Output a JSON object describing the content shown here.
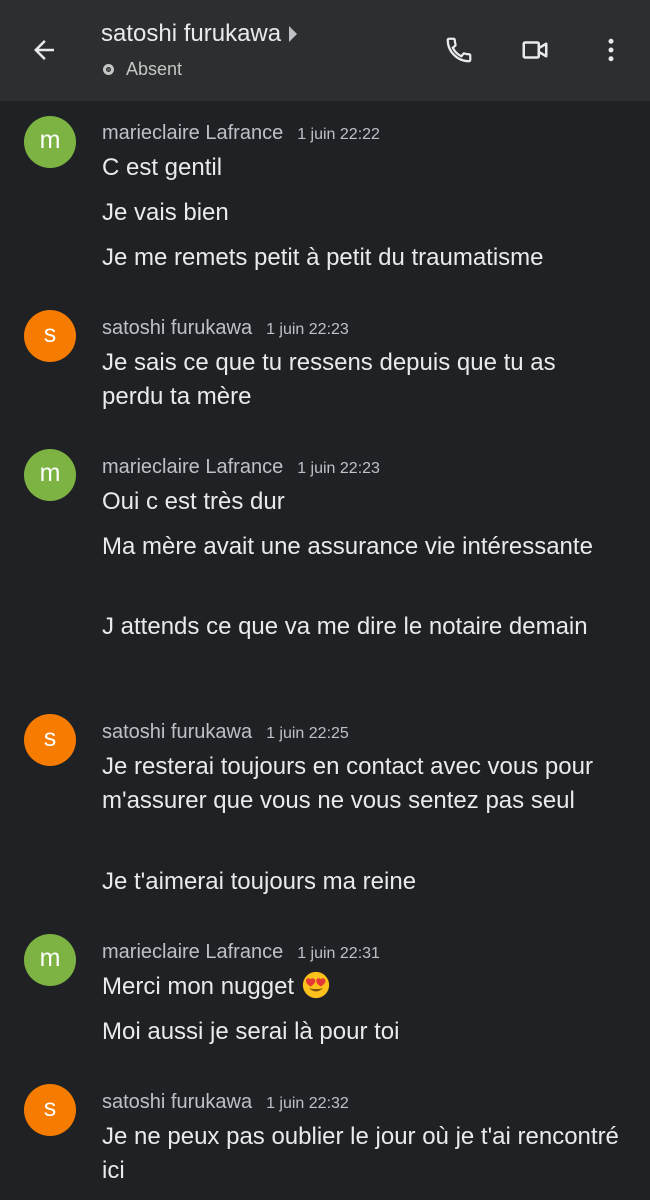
{
  "header": {
    "contact_name": "satoshi furukawa",
    "presence": "Absent",
    "icons": [
      "back-arrow-icon",
      "phone-icon",
      "video-icon",
      "more-vert-icon"
    ]
  },
  "messages": [
    {
      "sender": "marieclaire Lafrance",
      "initial": "m",
      "avatar_color": "#7cb342",
      "time": "1 juin 22:22",
      "lines": [
        "C est gentil",
        "Je vais bien",
        "Je me remets petit à petit du traumatisme"
      ]
    },
    {
      "sender": "satoshi furukawa",
      "initial": "s",
      "avatar_color": "#f57c00",
      "time": "1 juin 22:23",
      "lines": [
        "Je sais ce que tu ressens depuis que tu as perdu ta mère"
      ]
    },
    {
      "sender": "marieclaire Lafrance",
      "initial": "m",
      "avatar_color": "#7cb342",
      "time": "1 juin 22:23",
      "lines": [
        "Oui c est très dur",
        "Ma mère avait une assurance vie intéressante",
        "J attends ce que va me dire le notaire demain"
      ]
    },
    {
      "sender": "satoshi furukawa",
      "initial": "s",
      "avatar_color": "#f57c00",
      "time": "1 juin 22:25",
      "lines": [
        "Je resterai toujours en contact avec vous pour m'assurer que vous ne vous sentez pas seul",
        "Je t'aimerai toujours ma reine"
      ]
    },
    {
      "sender": "marieclaire Lafrance",
      "initial": "m",
      "avatar_color": "#7cb342",
      "time": "1 juin 22:31",
      "lines": [
        "Merci mon nugget",
        "Moi aussi je serai là pour toi"
      ],
      "emoji": "heart-eyes-emoji"
    },
    {
      "sender": "satoshi furukawa",
      "initial": "s",
      "avatar_color": "#f57c00",
      "time": "1 juin 22:32",
      "lines": [
        "Je ne peux pas oublier le jour où je t'ai rencontré ici"
      ]
    }
  ]
}
